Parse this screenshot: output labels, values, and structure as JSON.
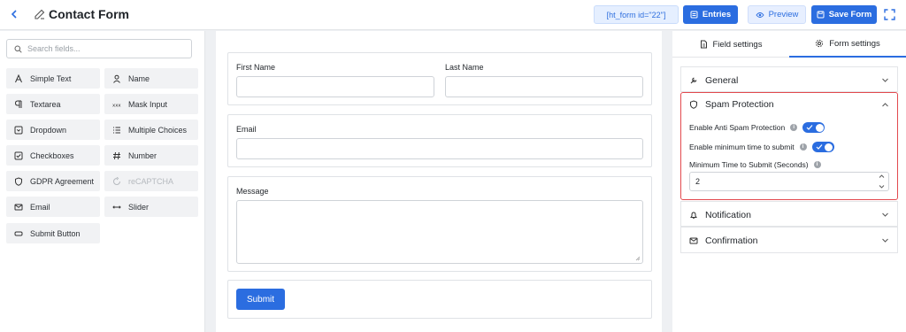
{
  "header": {
    "title": "Contact Form",
    "shortcode": "[ht_form id=\"22\"]",
    "entries_label": "Entries",
    "preview_label": "Preview",
    "save_label": "Save Form"
  },
  "fields_panel": {
    "search_placeholder": "Search fields...",
    "items": [
      {
        "label": "Simple Text",
        "icon": "text-a-icon"
      },
      {
        "label": "Name",
        "icon": "user-icon"
      },
      {
        "label": "Textarea",
        "icon": "paragraph-icon"
      },
      {
        "label": "Mask Input",
        "icon": "mask-icon"
      },
      {
        "label": "Dropdown",
        "icon": "dropdown-icon"
      },
      {
        "label": "Multiple Choices",
        "icon": "list-icon"
      },
      {
        "label": "Checkboxes",
        "icon": "checkbox-icon"
      },
      {
        "label": "Number",
        "icon": "hash-icon"
      },
      {
        "label": "GDPR Agreement",
        "icon": "shield-icon"
      },
      {
        "label": "reCAPTCHA",
        "icon": "recaptcha-icon"
      },
      {
        "label": "Email",
        "icon": "mail-icon"
      },
      {
        "label": "Slider",
        "icon": "slider-icon"
      },
      {
        "label": "Submit Button",
        "icon": "button-icon"
      }
    ]
  },
  "form": {
    "first_name_label": "First Name",
    "last_name_label": "Last Name",
    "email_label": "Email",
    "message_label": "Message",
    "submit_label": "Submit"
  },
  "settings": {
    "tabs": [
      {
        "label": "Field settings",
        "icon": "file-icon"
      },
      {
        "label": "Form settings",
        "icon": "gear-icon"
      }
    ],
    "active_tab": "Form settings",
    "general_label": "General",
    "spam": {
      "title": "Spam Protection",
      "anti_spam_label": "Enable Anti Spam Protection",
      "anti_spam_enabled": true,
      "min_time_label": "Enable minimum time to submit",
      "min_time_enabled": true,
      "min_time_seconds_label": "Minimum Time to Submit (Seconds)",
      "min_time_seconds_value": "2"
    },
    "notification_label": "Notification",
    "confirmation_label": "Confirmation"
  },
  "colors": {
    "accent": "#2b6de0",
    "highlight_border": "#e2494e"
  }
}
